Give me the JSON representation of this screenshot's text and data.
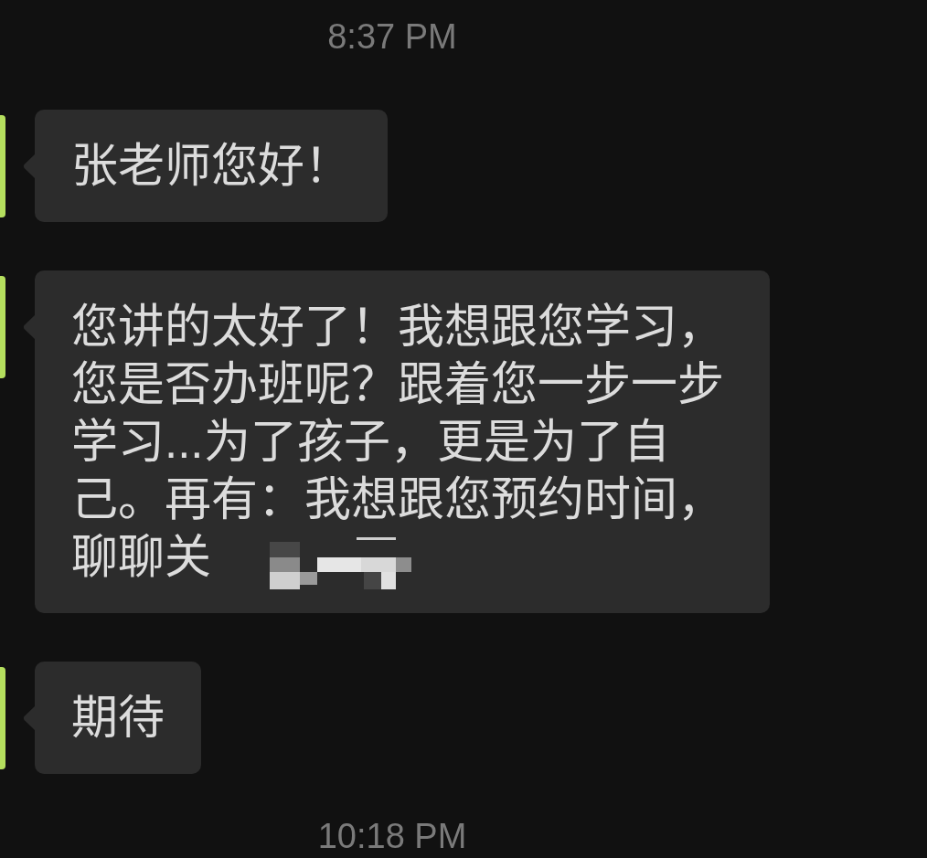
{
  "messages": [
    {
      "kind": "time",
      "text": "8:37 PM"
    },
    {
      "kind": "incoming",
      "text": "张老师您好！",
      "redacted": false
    },
    {
      "kind": "incoming",
      "text": "您讲的太好了！我想跟您学习，您是否办班呢？跟着您一步一步学习...为了孩子，更是为了自己。再有：我想跟您预约时间，聊聊关",
      "redacted": true
    },
    {
      "kind": "incoming",
      "text": "期待",
      "redacted": false
    },
    {
      "kind": "time",
      "text": "10:18 PM"
    }
  ]
}
